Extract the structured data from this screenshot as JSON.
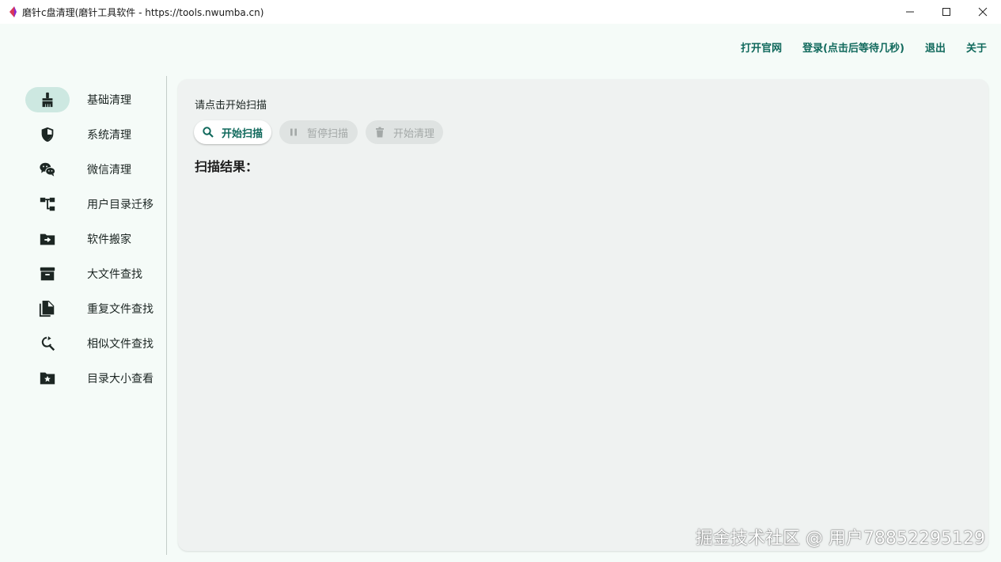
{
  "window": {
    "title": "磨针c盘清理(磨针工具软件 - https://tools.nwumba.cn)"
  },
  "topnav": {
    "items": [
      {
        "label": "打开官网"
      },
      {
        "label": "登录(点击后等待几秒)"
      },
      {
        "label": "退出"
      },
      {
        "label": "关于"
      }
    ]
  },
  "sidebar": {
    "items": [
      {
        "label": "基础清理",
        "icon": "broom-icon",
        "active": true
      },
      {
        "label": "系统清理",
        "icon": "shield-icon",
        "active": false
      },
      {
        "label": "微信清理",
        "icon": "wechat-icon",
        "active": false
      },
      {
        "label": "用户目录迁移",
        "icon": "tree-structure-icon",
        "active": false
      },
      {
        "label": "软件搬家",
        "icon": "folder-move-icon",
        "active": false
      },
      {
        "label": "大文件查找",
        "icon": "archive-box-icon",
        "active": false
      },
      {
        "label": "重复文件查找",
        "icon": "file-copy-icon",
        "active": false
      },
      {
        "label": "相似文件查找",
        "icon": "find-replace-icon",
        "active": false
      },
      {
        "label": "目录大小查看",
        "icon": "folder-star-icon",
        "active": false
      }
    ]
  },
  "main": {
    "status": "请点击开始扫描",
    "buttons": {
      "start_scan": "开始扫描",
      "pause_scan": "暂停扫描",
      "start_clean": "开始清理"
    },
    "result_label": "扫描结果："
  },
  "watermark": "掘金技术社区 @ 用户78852295129",
  "colors": {
    "accent": "#10695c",
    "active_indicator": "#cde8e1",
    "background": "#f5fbf8",
    "panel": "#eff2f1",
    "disabled_button": "#dfe3e2"
  }
}
